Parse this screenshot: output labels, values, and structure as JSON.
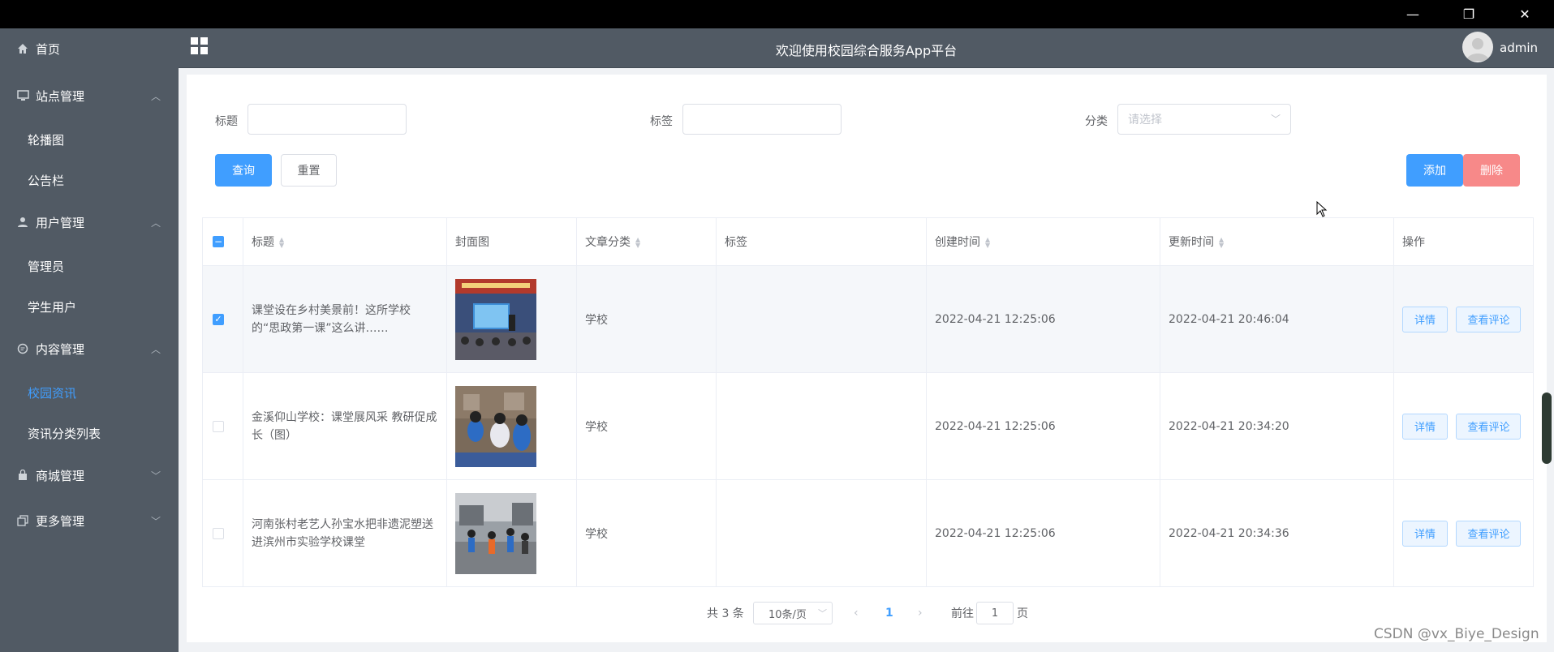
{
  "window": {
    "minimize": "—",
    "restore": "❐",
    "close": "✕"
  },
  "sidebar": {
    "items": [
      {
        "label": "首页",
        "icon": "home-icon"
      },
      {
        "label": "站点管理",
        "icon": "monitor-icon"
      },
      {
        "label": "轮播图"
      },
      {
        "label": "公告栏"
      },
      {
        "label": "用户管理",
        "icon": "user-icon"
      },
      {
        "label": "管理员"
      },
      {
        "label": "学生用户"
      },
      {
        "label": "内容管理",
        "icon": "chat-icon"
      },
      {
        "label": "校园资讯"
      },
      {
        "label": "资讯分类列表"
      },
      {
        "label": "商城管理",
        "icon": "shop-icon"
      },
      {
        "label": "更多管理",
        "icon": "copy-icon"
      }
    ]
  },
  "header": {
    "title": "欢迎使用校园综合服务App平台",
    "user": "admin"
  },
  "search": {
    "title_label": "标题",
    "tag_label": "标签",
    "category_label": "分类",
    "category_placeholder": "请选择",
    "query_btn": "查询",
    "reset_btn": "重置",
    "add_btn": "添加",
    "delete_btn": "删除"
  },
  "table": {
    "headers": [
      "标题",
      "封面图",
      "文章分类",
      "标签",
      "创建时间",
      "更新时间",
      "操作"
    ],
    "detail_btn": "详情",
    "comment_btn": "查看评论",
    "rows": [
      {
        "checked": true,
        "title": "课堂设在乡村美景前！这所学校的“思政第一课”这么讲……",
        "category": "学校",
        "tag": "",
        "created": "2022-04-21 12:25:06",
        "updated": "2022-04-21 20:46:04"
      },
      {
        "checked": false,
        "title": "金溪仰山学校：课堂展风采 教研促成长（图）",
        "category": "学校",
        "tag": "",
        "created": "2022-04-21 12:25:06",
        "updated": "2022-04-21 20:34:20"
      },
      {
        "checked": false,
        "title": "河南张村老艺人孙宝水把非遗泥塑送进滨州市实验学校课堂",
        "category": "学校",
        "tag": "",
        "created": "2022-04-21 12:25:06",
        "updated": "2022-04-21 20:34:36"
      }
    ]
  },
  "pagination": {
    "total": "共 3 条",
    "page_size": "10条/页",
    "current": "1",
    "goto_prefix": "前往",
    "goto_value": "1",
    "goto_suffix": "页"
  },
  "watermark": "CSDN @vx_Biye_Design",
  "colors": {
    "sidebar": "#515a64",
    "primary": "#409eff",
    "danger": "#f78989"
  }
}
